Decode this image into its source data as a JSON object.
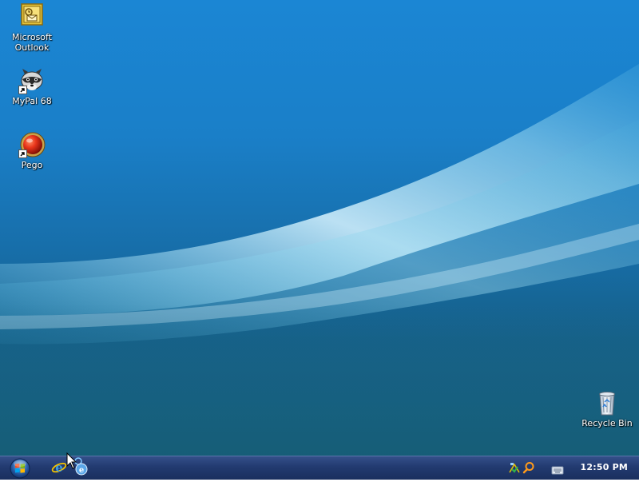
{
  "desktop": {
    "icons": [
      {
        "label": "Microsoft\nOutlook",
        "icon": "outlook-icon"
      },
      {
        "label": "MyPal 68",
        "icon": "raccoon-icon"
      },
      {
        "label": "Pego",
        "icon": "red-ball-icon"
      },
      {
        "label": "Recycle Bin",
        "icon": "recycle-bin-icon"
      }
    ]
  },
  "taskbar": {
    "start_icon": "windows-start-orb",
    "quick_launch": [
      {
        "icon": "internet-explorer-icon"
      },
      {
        "icon": "ie-loading-icon"
      }
    ],
    "tray": {
      "icons": [
        "keyboard-icon",
        "network-icon",
        "search-icon"
      ],
      "clock": "12:50 PM"
    }
  },
  "colors": {
    "wallpaper_top": "#1b86d4",
    "wallpaper_bottom": "#175a74",
    "taskbar": "#223a70"
  }
}
